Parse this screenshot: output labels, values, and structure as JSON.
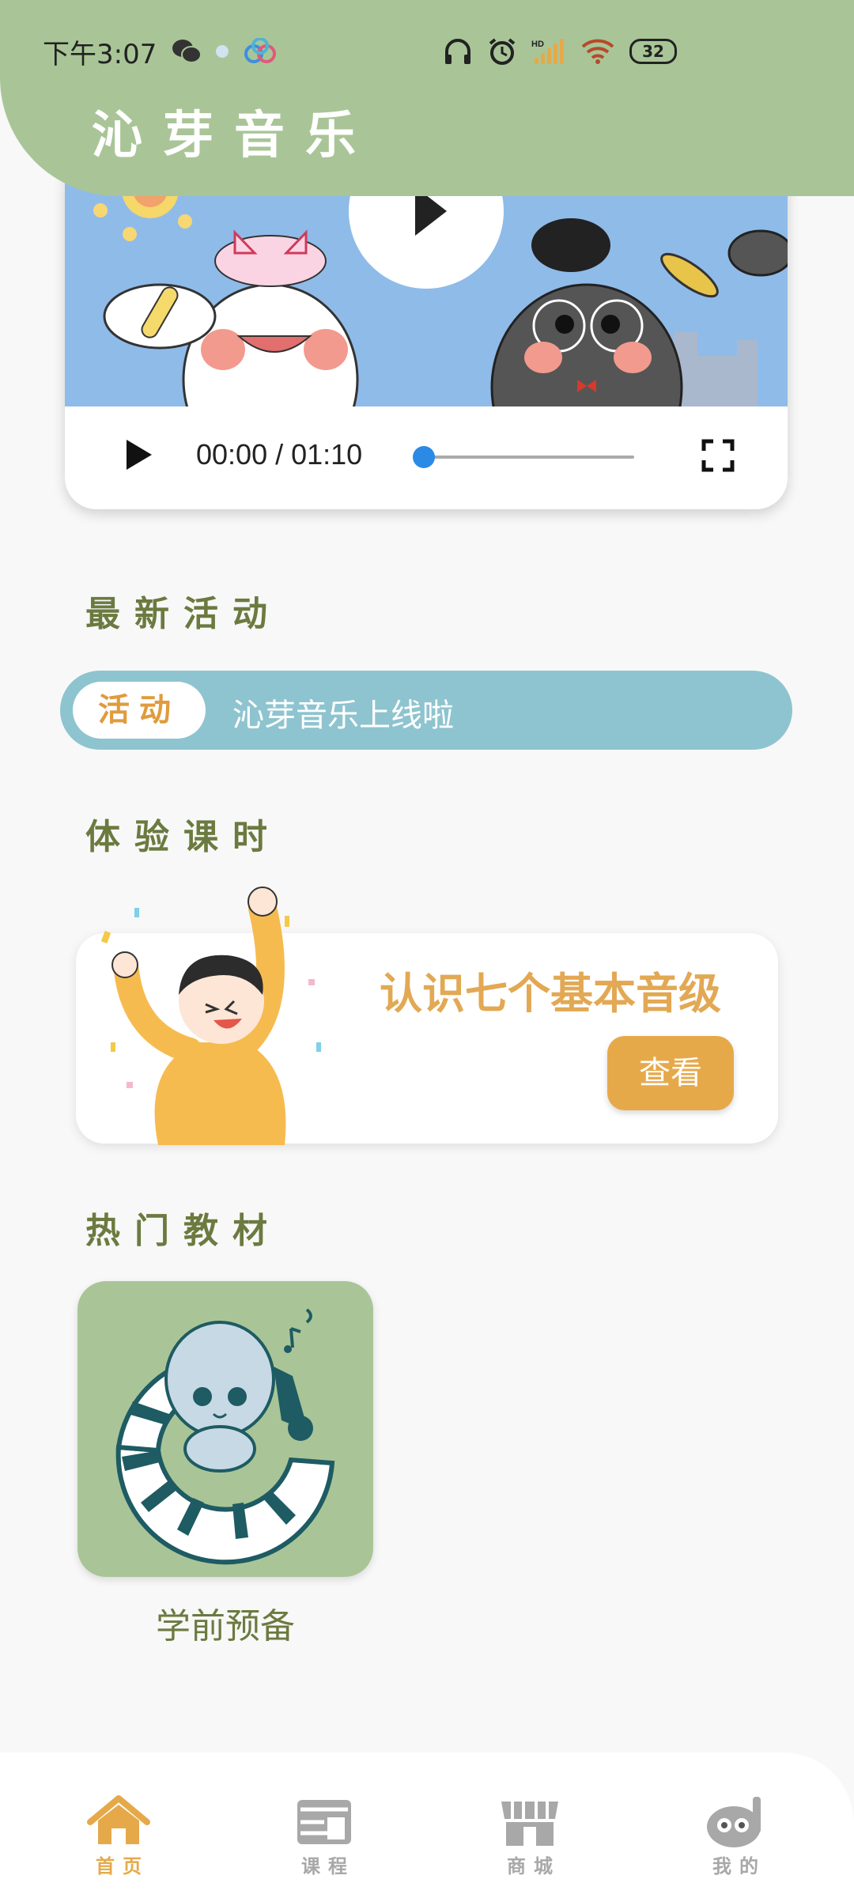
{
  "status_bar": {
    "time": "下午3:07",
    "left_icons": [
      "wechat-icon",
      "notification-icon",
      "app-icon"
    ],
    "right_icons": [
      "headphones-icon",
      "alarm-icon",
      "hd-signal-icon",
      "wifi-icon"
    ],
    "battery": "32"
  },
  "header": {
    "title": "沁芽音乐"
  },
  "video": {
    "time_display": "00:00 / 01:10",
    "progress": 0
  },
  "sections": {
    "activity_title": "最新活动",
    "experience_title": "体验课时",
    "hot_title": "热门教材"
  },
  "activity": {
    "tag": "活动",
    "text": "沁芽音乐上线啦"
  },
  "experience": {
    "title": "认识七个基本音级",
    "button": "查看"
  },
  "books": [
    {
      "name": "学前预备"
    }
  ],
  "nav": {
    "items": [
      {
        "label": "首页",
        "icon": "home-icon",
        "active": true
      },
      {
        "label": "课程",
        "icon": "course-icon",
        "active": false
      },
      {
        "label": "商城",
        "icon": "store-icon",
        "active": false
      },
      {
        "label": "我的",
        "icon": "profile-icon",
        "active": false
      }
    ]
  },
  "colors": {
    "header_bg": "#a9c597",
    "accent_orange": "#e6a94a",
    "section_title": "#6b7a3f",
    "activity_bar": "#8ec4cf",
    "nav_active": "#e6a94a",
    "nav_inactive": "#a8a8a8"
  }
}
